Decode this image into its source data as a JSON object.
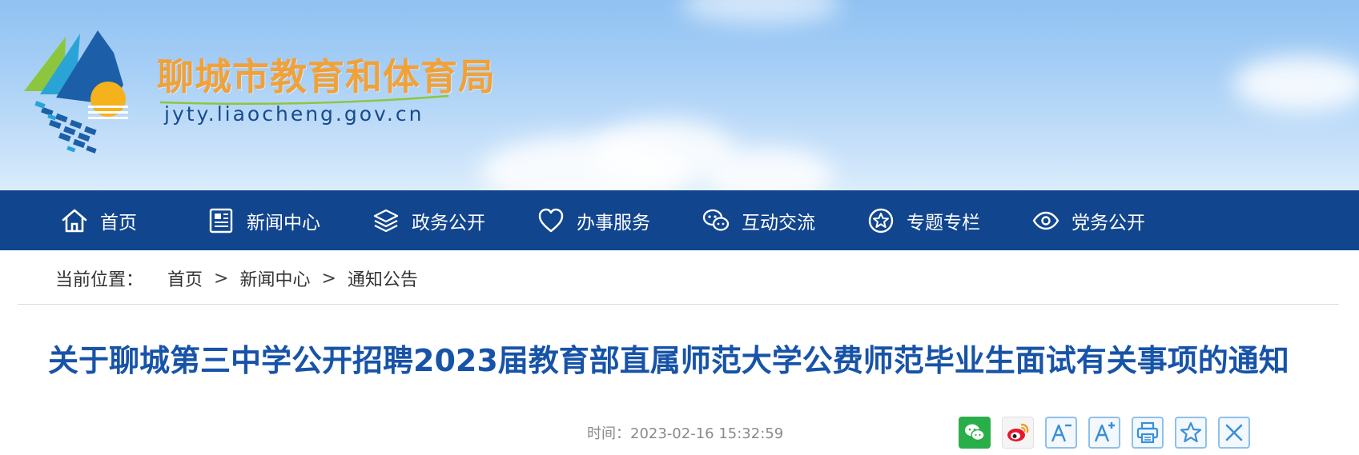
{
  "header": {
    "site_name_cn": "聊城市教育和体育局",
    "site_domain": "jyty.liaocheng.gov.cn",
    "colors": {
      "title_orange": "#f0a13a",
      "domain_blue": "#184a8c"
    }
  },
  "nav": {
    "background": "#11458e",
    "items": [
      {
        "label": "首页",
        "icon": "home-icon"
      },
      {
        "label": "新闻中心",
        "icon": "newspaper-icon"
      },
      {
        "label": "政务公开",
        "icon": "layers-icon"
      },
      {
        "label": "办事服务",
        "icon": "heart-icon"
      },
      {
        "label": "互动交流",
        "icon": "chat-icon"
      },
      {
        "label": "专题专栏",
        "icon": "star-badge-icon"
      },
      {
        "label": "党务公开",
        "icon": "eye-icon"
      }
    ]
  },
  "breadcrumb": {
    "prefix": "当前位置：",
    "items": [
      "首页",
      "新闻中心",
      "通知公告"
    ],
    "separator": ">"
  },
  "article": {
    "title": "关于聊城第三中学公开招聘2023届教育部直属师范大学公费师范毕业生面试有关事项的通知",
    "time_label": "时间：",
    "time_value": "2023-02-16 15:32:59",
    "title_color": "#1753a8"
  },
  "tools": [
    {
      "name": "wechat-share",
      "icon": "wechat-icon"
    },
    {
      "name": "weibo-share",
      "icon": "weibo-icon"
    },
    {
      "name": "font-decrease",
      "icon": "font-decrease-icon"
    },
    {
      "name": "font-increase",
      "icon": "font-increase-icon"
    },
    {
      "name": "print",
      "icon": "print-icon"
    },
    {
      "name": "favorite",
      "icon": "star-outline-icon"
    },
    {
      "name": "close",
      "icon": "close-icon"
    }
  ]
}
